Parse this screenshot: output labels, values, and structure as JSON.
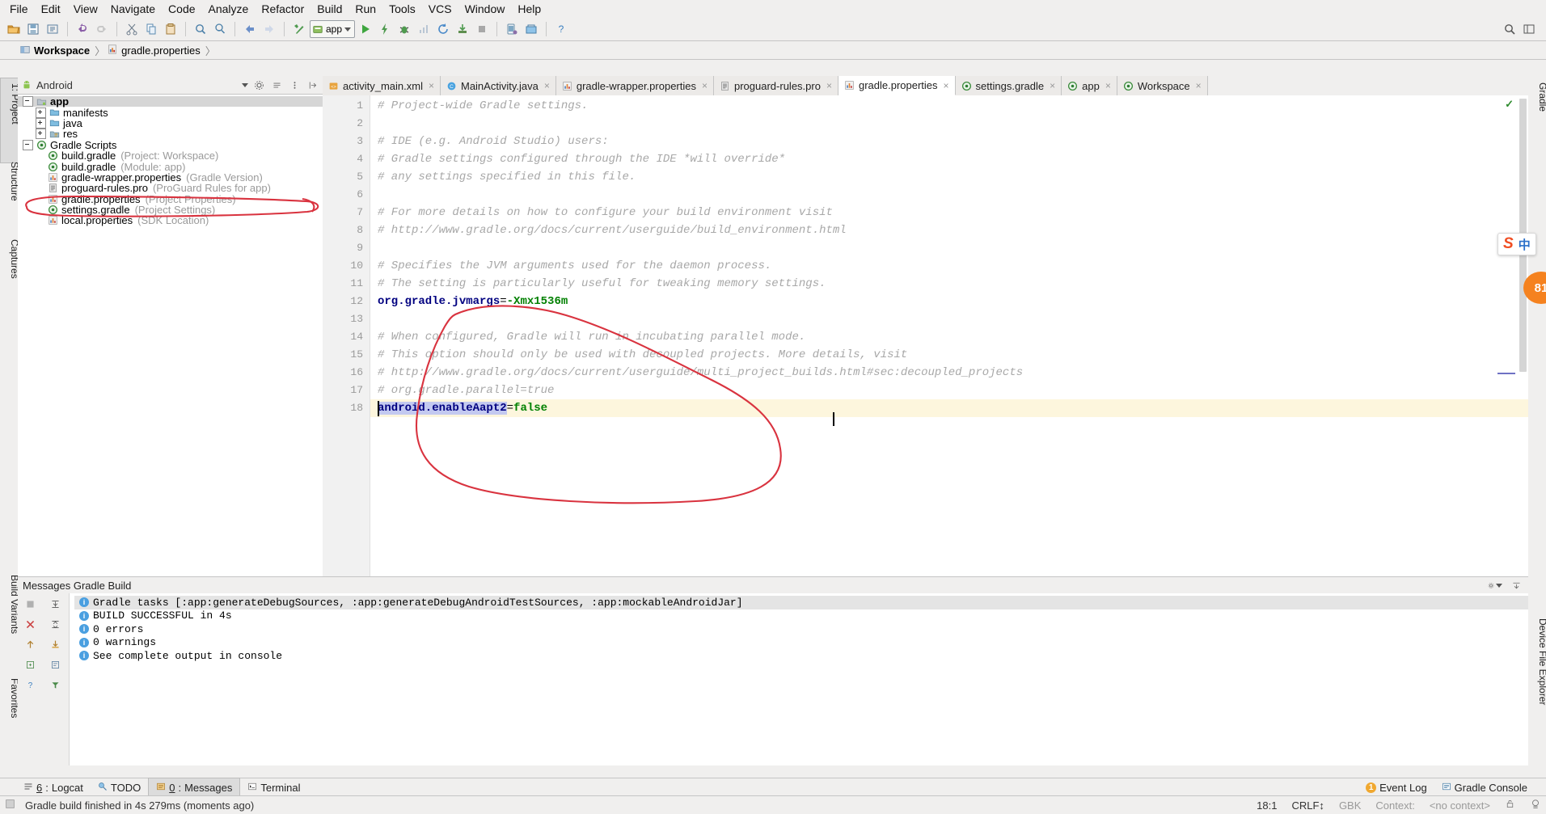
{
  "menubar": {
    "items": [
      "File",
      "Edit",
      "View",
      "Navigate",
      "Code",
      "Analyze",
      "Refactor",
      "Build",
      "Run",
      "Tools",
      "VCS",
      "Window",
      "Help"
    ]
  },
  "toolbar": {
    "run_config": "app",
    "icons": [
      "open-folder-icon",
      "save-all-icon",
      "sync-icon",
      "undo-icon",
      "redo-icon",
      "cut-icon",
      "copy-icon",
      "paste-icon",
      "find-icon",
      "replace-icon",
      "back-icon",
      "forward-icon",
      "build-icon",
      "run-icon",
      "apply-changes-icon",
      "debug-icon",
      "profile-icon",
      "rerun-icon",
      "sync-gradle-icon",
      "stop-icon",
      "avd-manager-icon",
      "sdk-manager-icon",
      "help-icon",
      "search-everywhere-icon",
      "layout-icon"
    ]
  },
  "breadcrumb": {
    "items": [
      {
        "label": "Workspace",
        "icon": "module-icon"
      },
      {
        "label": "gradle.properties",
        "icon": "properties-file-icon"
      }
    ],
    "separator": "〉"
  },
  "left_strips": {
    "top": [
      {
        "label": "1: Project",
        "selected": true
      },
      {
        "label": "Structure",
        "selected": false
      },
      {
        "label": "Captures",
        "selected": false
      }
    ],
    "bottom": [
      {
        "label": "Build Variants",
        "selected": false
      },
      {
        "label": "Favorites",
        "selected": false
      }
    ]
  },
  "right_strips": {
    "top": [
      {
        "label": "Gradle",
        "selected": false
      }
    ],
    "bottom": [
      {
        "label": "Device File Explorer",
        "selected": false
      }
    ]
  },
  "project_panel": {
    "dropdown_value": "Android",
    "dropdown_icon": "android-icon",
    "tools": [
      "settings-gear-icon",
      "collapse-all-icon",
      "hide-icon",
      "more-icon"
    ],
    "tree": [
      {
        "depth": 0,
        "toggle": "minus",
        "icon": "module-folder-icon",
        "label": "app",
        "hint": "",
        "bold": true,
        "selected": true
      },
      {
        "depth": 1,
        "toggle": "plus",
        "icon": "folder-icon",
        "label": "manifests",
        "hint": "",
        "bold": false,
        "selected": false
      },
      {
        "depth": 1,
        "toggle": "plus",
        "icon": "folder-icon",
        "label": "java",
        "hint": "",
        "bold": false,
        "selected": false
      },
      {
        "depth": 1,
        "toggle": "plus",
        "icon": "res-folder-icon",
        "label": "res",
        "hint": "",
        "bold": false,
        "selected": false
      },
      {
        "depth": 0,
        "toggle": "minus",
        "icon": "gradle-icon",
        "label": "Gradle Scripts",
        "hint": "",
        "bold": false,
        "selected": false
      },
      {
        "depth": 1,
        "toggle": "none",
        "icon": "gradle-icon",
        "label": "build.gradle",
        "hint": "(Project: Workspace)",
        "bold": false,
        "selected": false
      },
      {
        "depth": 1,
        "toggle": "none",
        "icon": "gradle-icon",
        "label": "build.gradle",
        "hint": "(Module: app)",
        "bold": false,
        "selected": false
      },
      {
        "depth": 1,
        "toggle": "none",
        "icon": "properties-file-icon",
        "label": "gradle-wrapper.properties",
        "hint": "(Gradle Version)",
        "bold": false,
        "selected": false
      },
      {
        "depth": 1,
        "toggle": "none",
        "icon": "text-file-icon",
        "label": "proguard-rules.pro",
        "hint": "(ProGuard Rules for app)",
        "bold": false,
        "selected": false
      },
      {
        "depth": 1,
        "toggle": "none",
        "icon": "properties-file-icon",
        "label": "gradle.properties",
        "hint": "(Project Properties)",
        "bold": false,
        "selected": false
      },
      {
        "depth": 1,
        "toggle": "none",
        "icon": "gradle-icon",
        "label": "settings.gradle",
        "hint": "(Project Settings)",
        "bold": false,
        "selected": false
      },
      {
        "depth": 1,
        "toggle": "none",
        "icon": "properties-file-icon",
        "label": "local.properties",
        "hint": "(SDK Location)",
        "bold": false,
        "selected": false
      }
    ]
  },
  "editor": {
    "tabs": [
      {
        "label": "activity_main.xml",
        "icon": "xml-layout-icon",
        "active": false
      },
      {
        "label": "MainActivity.java",
        "icon": "java-class-icon",
        "active": false
      },
      {
        "label": "gradle-wrapper.properties",
        "icon": "properties-file-icon",
        "active": false
      },
      {
        "label": "proguard-rules.pro",
        "icon": "text-file-icon",
        "active": false
      },
      {
        "label": "gradle.properties",
        "icon": "properties-file-icon",
        "active": true
      },
      {
        "label": "settings.gradle",
        "icon": "gradle-icon",
        "active": false
      },
      {
        "label": "app",
        "icon": "gradle-icon",
        "active": false
      },
      {
        "label": "Workspace",
        "icon": "gradle-icon",
        "active": false
      }
    ],
    "close_glyph": "×",
    "cursor_line": 18,
    "lines": [
      {
        "n": 1,
        "type": "comment",
        "text": "# Project-wide Gradle settings."
      },
      {
        "n": 2,
        "type": "blank",
        "text": ""
      },
      {
        "n": 3,
        "type": "comment",
        "text": "# IDE (e.g. Android Studio) users:"
      },
      {
        "n": 4,
        "type": "comment",
        "text": "# Gradle settings configured through the IDE *will override*"
      },
      {
        "n": 5,
        "type": "comment",
        "text": "# any settings specified in this file."
      },
      {
        "n": 6,
        "type": "blank",
        "text": ""
      },
      {
        "n": 7,
        "type": "comment",
        "text": "# For more details on how to configure your build environment visit"
      },
      {
        "n": 8,
        "type": "comment",
        "text": "# http://www.gradle.org/docs/current/userguide/build_environment.html"
      },
      {
        "n": 9,
        "type": "blank",
        "text": ""
      },
      {
        "n": 10,
        "type": "comment",
        "text": "# Specifies the JVM arguments used for the daemon process."
      },
      {
        "n": 11,
        "type": "comment",
        "text": "# The setting is particularly useful for tweaking memory settings."
      },
      {
        "n": 12,
        "type": "property",
        "key": "org.gradle.jvmargs",
        "eq": "=",
        "value": "-Xmx1536m"
      },
      {
        "n": 13,
        "type": "blank",
        "text": ""
      },
      {
        "n": 14,
        "type": "comment",
        "text": "# When configured, Gradle will run in incubating parallel mode."
      },
      {
        "n": 15,
        "type": "comment",
        "text": "# This option should only be used with decoupled projects. More details, visit"
      },
      {
        "n": 16,
        "type": "comment",
        "text": "# http://www.gradle.org/docs/current/userguide/multi_project_builds.html#sec:decoupled_projects"
      },
      {
        "n": 17,
        "type": "comment",
        "text": "# org.gradle.parallel=true"
      },
      {
        "n": 18,
        "type": "property",
        "key": "android.enableAapt2",
        "eq": "=",
        "value": "false",
        "selected": true
      }
    ]
  },
  "messages_panel": {
    "title": "Messages Gradle Build",
    "tools": [
      "stop-icon",
      "expand-all-icon",
      "close-icon",
      "collapse-all-icon",
      "up-icon",
      "export-icon",
      "wrap-icon",
      "filter-icon",
      "help-icon"
    ],
    "rows": [
      {
        "text": "Gradle tasks [:app:generateDebugSources, :app:generateDebugAndroidTestSources, :app:mockableAndroidJar]",
        "selected": true
      },
      {
        "text": "BUILD SUCCESSFUL in 4s",
        "selected": false
      },
      {
        "text": "0 errors",
        "selected": false
      },
      {
        "text": "0 warnings",
        "selected": false
      },
      {
        "text": "See complete output in console",
        "selected": false
      }
    ],
    "info_glyph": "i"
  },
  "bottom_tabs": {
    "items": [
      {
        "num": "6",
        "label": "Logcat",
        "icon": "logcat-icon",
        "active": false
      },
      {
        "num": "",
        "label": "TODO",
        "icon": "todo-icon",
        "active": false
      },
      {
        "num": "0",
        "label": "Messages",
        "icon": "messages-icon",
        "active": true
      },
      {
        "num": "",
        "label": "Terminal",
        "icon": "terminal-icon",
        "active": false
      }
    ],
    "right": [
      {
        "label": "Event Log",
        "icon": "event-log-icon",
        "badge": "1"
      },
      {
        "label": "Gradle Console",
        "icon": "gradle-console-icon",
        "badge": ""
      }
    ]
  },
  "status_bar": {
    "message": "Gradle build finished in 4s 279ms (moments ago)",
    "message_icon": "build-status-icon",
    "position": "18:1",
    "line_separator": "CRLF↕",
    "encoding": "GBK",
    "context_label": "Context:",
    "context_value": "<no context>",
    "icons": [
      "lock-icon",
      "inspection-icon"
    ]
  },
  "floating": {
    "ime_s": "S",
    "ime_cn": "中",
    "bubble_text": "81"
  },
  "colors": {
    "comment": "#a8a8a8",
    "key": "#000080",
    "value": "#008000",
    "selection": "#c3c9f0",
    "cursor_line": "#fdf6dd",
    "annotation_red": "#d9333f",
    "panel_bg": "#f0efee",
    "accent_orange": "#f5821f",
    "info_blue": "#4a9fe0"
  }
}
